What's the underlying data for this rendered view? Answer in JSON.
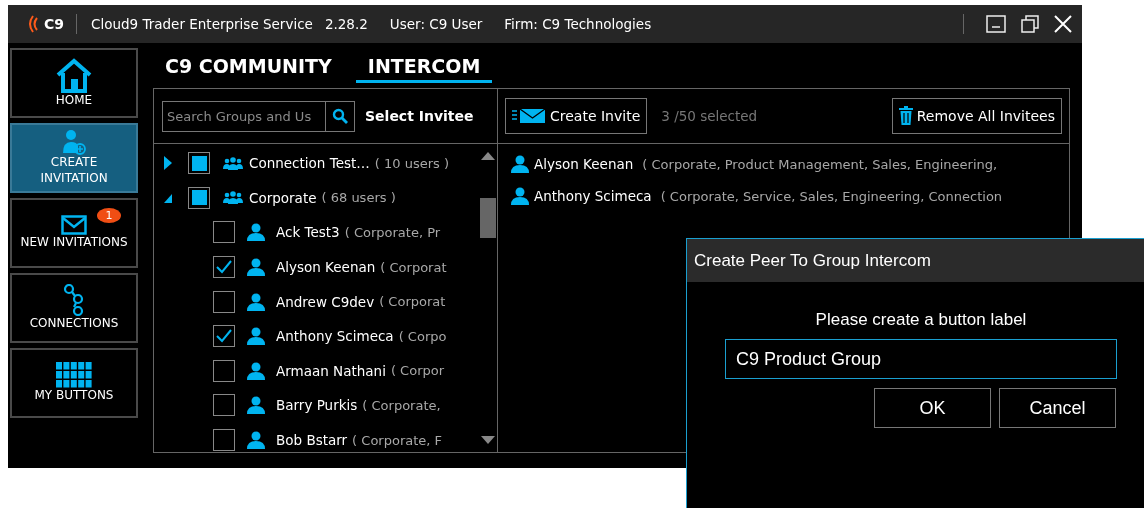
{
  "window": {
    "logo": "C9",
    "title": "Cloud9 Trader Enterprise Service",
    "version": "2.28.2",
    "user": "User: C9 User",
    "firm": "Firm: C9 Technologies"
  },
  "sidebar": {
    "items": [
      {
        "kind": "home",
        "label": "HOME",
        "selected": false
      },
      {
        "kind": "create",
        "label": "CREATE INVITATION",
        "selected": true
      },
      {
        "kind": "inbox",
        "label": "NEW INVITATIONS",
        "selected": false,
        "badge": "1"
      },
      {
        "kind": "connections",
        "label": "CONNECTIONS",
        "selected": false
      },
      {
        "kind": "buttons",
        "label": "MY BUTTONS",
        "selected": false
      }
    ]
  },
  "tabs": [
    {
      "label": "C9 COMMUNITY",
      "selected": false
    },
    {
      "label": "INTERCOM",
      "selected": true
    }
  ],
  "invitee_panel": {
    "search": {
      "placeholder": "Search Groups and Us"
    },
    "heading": "Select Invitee",
    "tree": [
      {
        "name": "Connection Test…",
        "count": "( 10 users )",
        "expanded": false,
        "checked": true
      },
      {
        "name": "Corporate",
        "count": "( 68 users )",
        "expanded": true,
        "checked": true,
        "children": [
          {
            "name": "Ack Test3",
            "detail": "( Corporate, Pr",
            "checked": false
          },
          {
            "name": "Alyson Keenan",
            "detail": "( Corporat",
            "checked": true
          },
          {
            "name": "Andrew C9dev",
            "detail": "( Corporat",
            "checked": false
          },
          {
            "name": "Anthony Scimeca",
            "detail": "( Corpo",
            "checked": true
          },
          {
            "name": "Armaan Nathani",
            "detail": "( Corpor",
            "checked": false
          },
          {
            "name": "Barry Purkis",
            "detail": "( Corporate,",
            "checked": false
          },
          {
            "name": "Bob Bstarr",
            "detail": "( Corporate, F",
            "checked": false
          }
        ]
      }
    ]
  },
  "invite_panel": {
    "create_button": "Create Invite",
    "selected_count": "3 /50 selected",
    "remove_button": "Remove All Invitees",
    "invitees": [
      {
        "name": "Alyson Keenan",
        "detail": "( Corporate, Product Management, Sales, Engineering,"
      },
      {
        "name": "Anthony Scimeca",
        "detail": "( Corporate, Service, Sales, Engineering, Connection"
      }
    ]
  },
  "dialog": {
    "title": "Create Peer To Group Intercom",
    "prompt": "Please create a button label",
    "value": "C9 Product Group",
    "buttons": [
      "OK",
      "Cancel"
    ]
  }
}
